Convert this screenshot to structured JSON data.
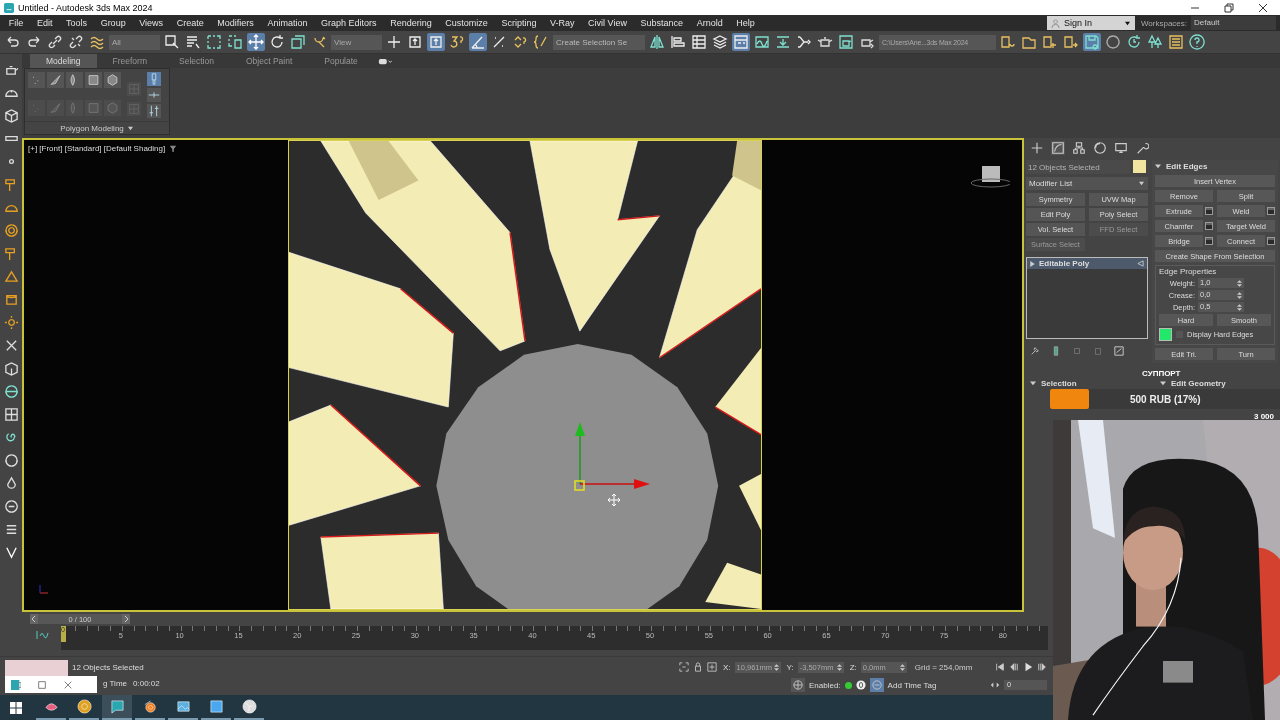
{
  "window": {
    "title": "Untitled - Autodesk 3ds Max 2024"
  },
  "menu": [
    "File",
    "Edit",
    "Tools",
    "Group",
    "Views",
    "Create",
    "Modifiers",
    "Animation",
    "Graph Editors",
    "Rendering",
    "Customize",
    "Scripting",
    "V-Ray",
    "Civil View",
    "Substance",
    "Arnold",
    "Help"
  ],
  "account": {
    "sign_in": "Sign In",
    "workspaces_label": "Workspaces:",
    "workspace": "Default"
  },
  "toolbar": {
    "filter": "All",
    "reference_coord": "View",
    "selection_set_placeholder": "Create Selection Se",
    "project_path": "C:\\Users\\Ane...3ds Max 2024",
    "groups": [
      {
        "tools": [
          {
            "selected": false
          },
          {
            "selected": false
          },
          {
            "selected": false
          },
          {
            "selected": false
          },
          {
            "selected": false
          }
        ]
      },
      {
        "tools": [
          {
            "selected": false
          },
          {
            "selected": false
          },
          {
            "selected": false
          },
          {
            "selected": false
          },
          {
            "selected": true
          },
          {
            "selected": false
          },
          {
            "selected": false
          },
          {
            "selected": false
          }
        ]
      },
      {
        "tools": [
          {
            "selected": false
          },
          {
            "selected": false
          },
          {
            "selected": true
          },
          {
            "selected": false
          },
          {
            "selected": true
          },
          {
            "selected": false
          },
          {
            "selected": false
          },
          {
            "selected": false
          }
        ]
      },
      {
        "tools": [
          {
            "selected": false
          },
          {
            "selected": false
          },
          {
            "selected": false
          },
          {
            "selected": false
          },
          {
            "selected": true
          },
          {
            "selected": false
          },
          {
            "selected": false
          },
          {
            "selected": false
          },
          {
            "selected": false
          },
          {
            "selected": false
          },
          {
            "selected": false
          }
        ]
      },
      {
        "tools": [
          {
            "selected": false
          },
          {
            "selected": false
          },
          {
            "selected": false
          },
          {
            "selected": false
          },
          {
            "selected": true
          },
          {
            "selected": false
          },
          {
            "selected": false
          },
          {
            "selected": false
          },
          {
            "selected": false
          },
          {
            "selected": false
          }
        ]
      }
    ]
  },
  "ribbon": {
    "tabs": [
      {
        "label": "Modeling",
        "selected": true
      },
      {
        "label": "Freeform",
        "selected": false
      },
      {
        "label": "Selection",
        "selected": false
      },
      {
        "label": "Object Paint",
        "selected": false
      },
      {
        "label": "Populate",
        "selected": false
      }
    ],
    "side_tools": [
      {
        "selected": true
      },
      {
        "selected": false
      },
      {
        "selected": false
      }
    ],
    "panel_title": "Polygon Modeling"
  },
  "viewport": {
    "label": "[+] [Front] [Standard] [Default Shading]"
  },
  "command_panel": {
    "tabs": [
      {
        "selected": false
      },
      {
        "selected": true
      },
      {
        "selected": false
      },
      {
        "selected": false
      },
      {
        "selected": false
      },
      {
        "selected": false
      }
    ],
    "selection_name": "12 Objects Selected",
    "modifier_list": "Modifier List",
    "modifier_buttons": [
      {
        "label": "Symmetry",
        "disabled": false
      },
      {
        "label": "UVW Map",
        "disabled": false
      },
      {
        "label": "Edit Poly",
        "disabled": false
      },
      {
        "label": "Poly Select",
        "disabled": false
      },
      {
        "label": "Vol. Select",
        "disabled": false
      },
      {
        "label": "FFD Select",
        "disabled": true
      },
      {
        "label": "Surface Select",
        "disabled": true
      }
    ],
    "stack": [
      {
        "label": "Editable Poly",
        "selected": true
      }
    ],
    "edit_edges": {
      "title": "Edit Edges",
      "expanded": true,
      "rows": [
        {
          "buttons": [
            {
              "label": "Insert Vertex",
              "settings": false
            }
          ]
        },
        {
          "buttons": [
            {
              "label": "Remove",
              "settings": false
            },
            {
              "label": "Split",
              "settings": false
            }
          ]
        },
        {
          "buttons": [
            {
              "label": "Extrude",
              "settings": true
            },
            {
              "label": "Weld",
              "settings": true
            }
          ]
        },
        {
          "buttons": [
            {
              "label": "Chamfer",
              "settings": true
            },
            {
              "label": "Target Weld",
              "settings": false
            }
          ]
        },
        {
          "buttons": [
            {
              "label": "Bridge",
              "settings": true
            },
            {
              "label": "Connect",
              "settings": true
            }
          ]
        },
        {
          "buttons": [
            {
              "label": "Create Shape From Selection",
              "settings": false
            }
          ]
        }
      ],
      "edge_properties": {
        "title": "Edge Properties",
        "fields": [
          {
            "label": "Weight:",
            "value": "1,0"
          },
          {
            "label": "Crease:",
            "value": "0,0"
          },
          {
            "label": "Depth:",
            "value": "0,5"
          }
        ],
        "buttons": [
          "Hard",
          "Smooth"
        ],
        "display_hard_edges": {
          "label": "Display Hard Edges",
          "checked": false
        }
      },
      "bottom_buttons": [
        "Edit Tri.",
        "Turn"
      ]
    },
    "rollouts": [
      {
        "title": "Selection",
        "expanded": true
      },
      {
        "title": "Edit Geometry",
        "expanded": true
      }
    ]
  },
  "donation": {
    "title": "СУППОРТ",
    "amount": "500 RUB (17%)",
    "goal": "3 000",
    "level": 0.17
  },
  "timeline": {
    "frame_counter": "0 / 100",
    "level": 0,
    "current_frame": "0",
    "ticks": [
      "5",
      "10",
      "15",
      "20",
      "25",
      "30",
      "35",
      "40",
      "45",
      "50",
      "55",
      "60",
      "65",
      "70",
      "75",
      "80"
    ]
  },
  "status": {
    "selection": "12 Objects Selected",
    "render_time_label": "g Time",
    "render_time": "0:00:02",
    "coords": [
      {
        "axis": "X:",
        "value": "10,961mm"
      },
      {
        "axis": "Y:",
        "value": "-3,507mm"
      },
      {
        "axis": "Z:",
        "value": "0,0mm"
      }
    ],
    "grid": "Grid = 254,0mm",
    "enabled_label": "Enabled:",
    "add_time_tag": "Add Time Tag",
    "frame": "0"
  },
  "taskbar": {
    "apps": [
      {
        "selected": false
      },
      {
        "selected": false
      },
      {
        "selected": true
      },
      {
        "selected": false
      },
      {
        "selected": false
      },
      {
        "selected": false
      },
      {
        "selected": false
      }
    ]
  }
}
